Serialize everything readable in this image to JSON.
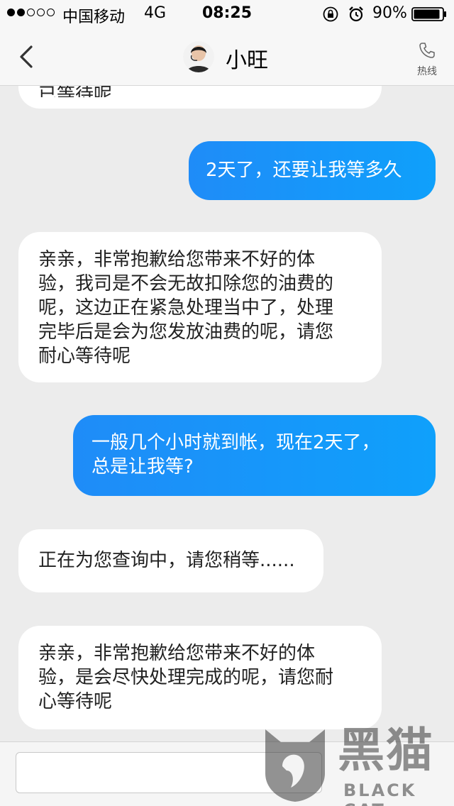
{
  "status_bar": {
    "signal_dots_filled": 2,
    "signal_dots_total": 5,
    "carrier": "中国移动",
    "network": "4G",
    "time": "08:25",
    "battery_percent": "90%",
    "battery_level": 0.9
  },
  "nav": {
    "back_icon": "chevron-left-icon",
    "title": "小旺",
    "hotline_icon": "phone-icon",
    "hotline_label": "热线"
  },
  "messages": [
    {
      "side": "in",
      "lines": [
        "已等待呢"
      ]
    },
    {
      "side": "out",
      "lines": [
        "2天了，还要让我等多久"
      ]
    },
    {
      "side": "in",
      "lines": [
        "亲亲，非常抱歉给您带来不好的体",
        "验，我司是不会无故扣除您的油费的",
        "呢，这边正在紧急处理当中了，处理",
        "完毕后是会为您发放油费的呢，请您",
        "耐心等待呢"
      ]
    },
    {
      "side": "out",
      "lines": [
        "一般几个小时就到帐，现在2天了，",
        "总是让我等?"
      ]
    },
    {
      "side": "in",
      "lines": [
        "正在为您查询中，请您稍等......"
      ]
    },
    {
      "side": "in",
      "lines": [
        "亲亲，非常抱歉给您带来不好的体",
        "验，是会尽快处理完成的呢，请您耐",
        "心等待呢"
      ]
    }
  ],
  "input": {
    "value": "",
    "placeholder": ""
  },
  "watermark": {
    "main": "黑猫",
    "sub": "BLACK CAT"
  },
  "colors": {
    "outgoing_bubble": "#1f8cf8",
    "incoming_bubble": "#ffffff",
    "background": "#ececec"
  }
}
